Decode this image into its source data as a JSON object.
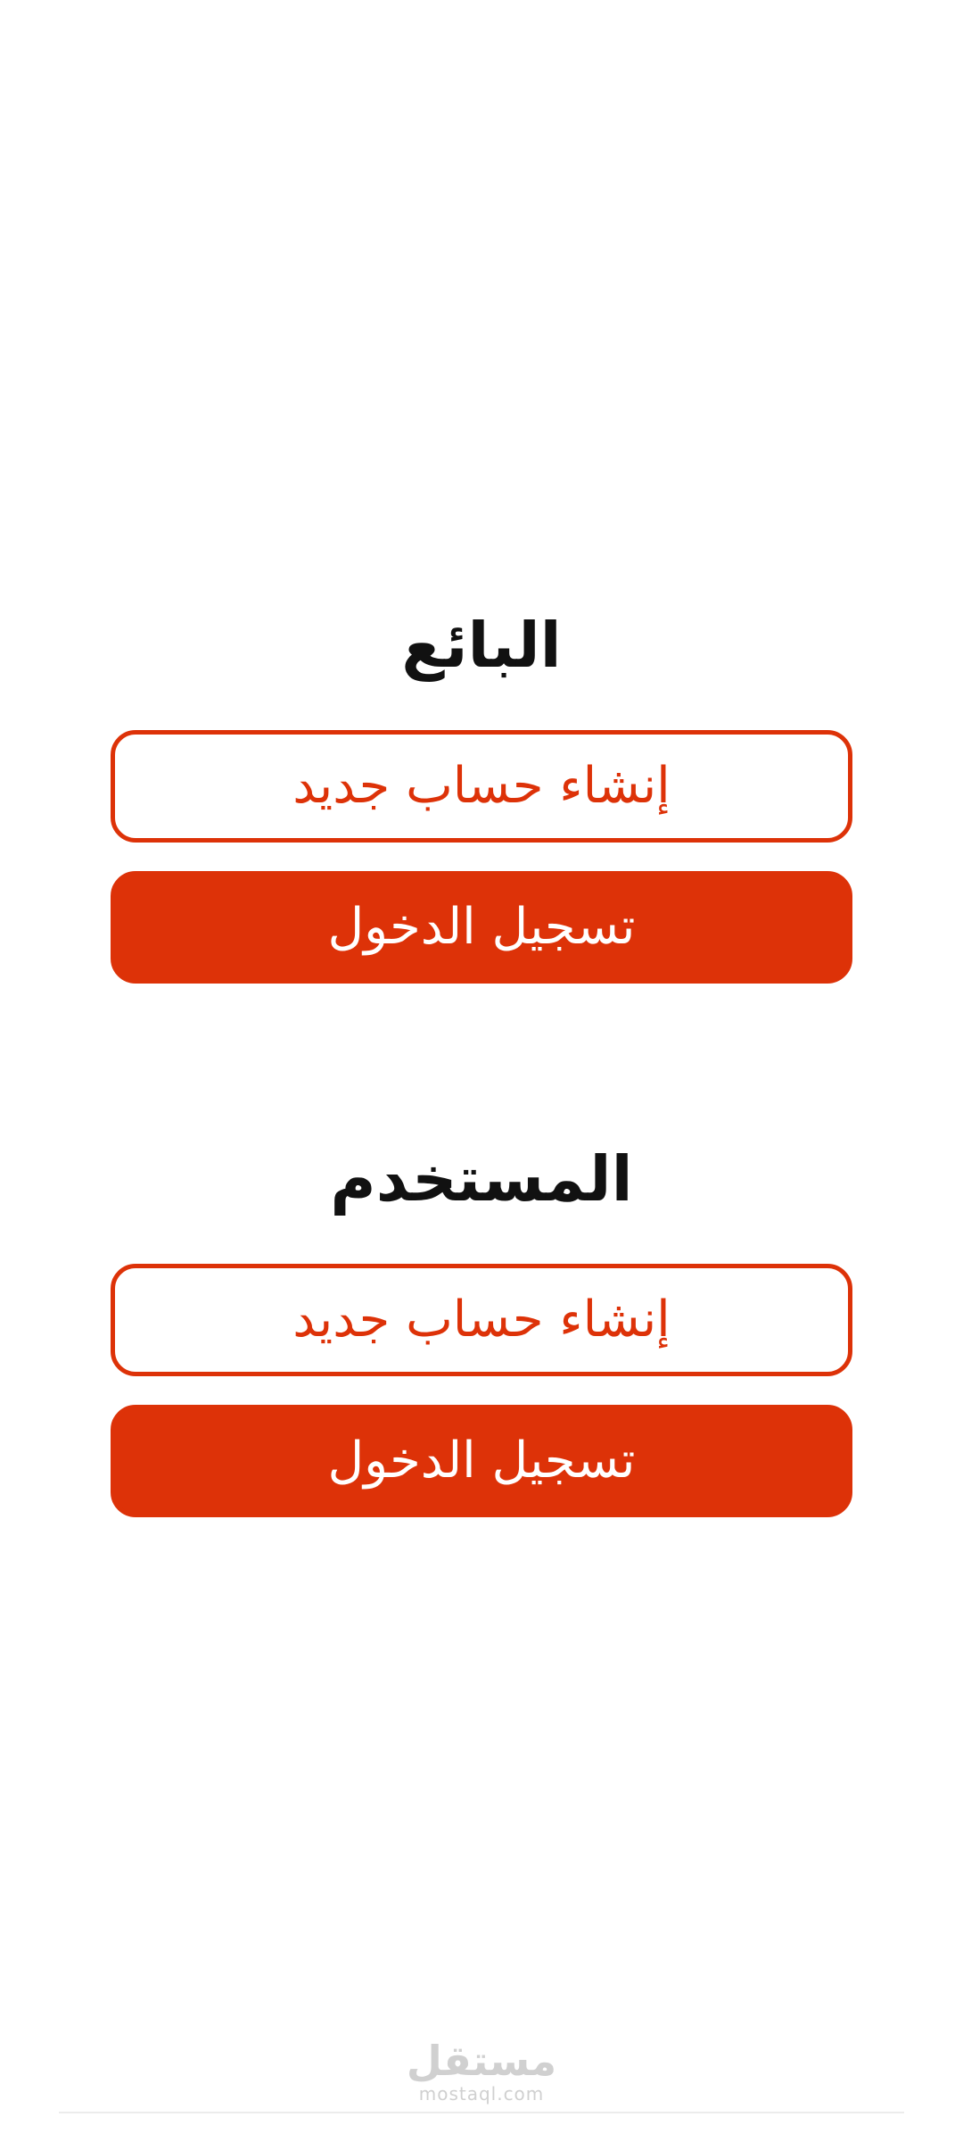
{
  "seller": {
    "title": "البائع",
    "create_account_label": "إنشاء حساب جديد",
    "login_label": "تسجيل الدخول"
  },
  "user": {
    "title": "المستخدم",
    "create_account_label": "إنشاء حساب جديد",
    "login_label": "تسجيل الدخول"
  },
  "watermark": {
    "logo_text": "مستقل",
    "url_text": "mostaql.com"
  },
  "colors": {
    "accent": "#dd3208",
    "background": "#ffffff",
    "title_text": "#111111"
  }
}
